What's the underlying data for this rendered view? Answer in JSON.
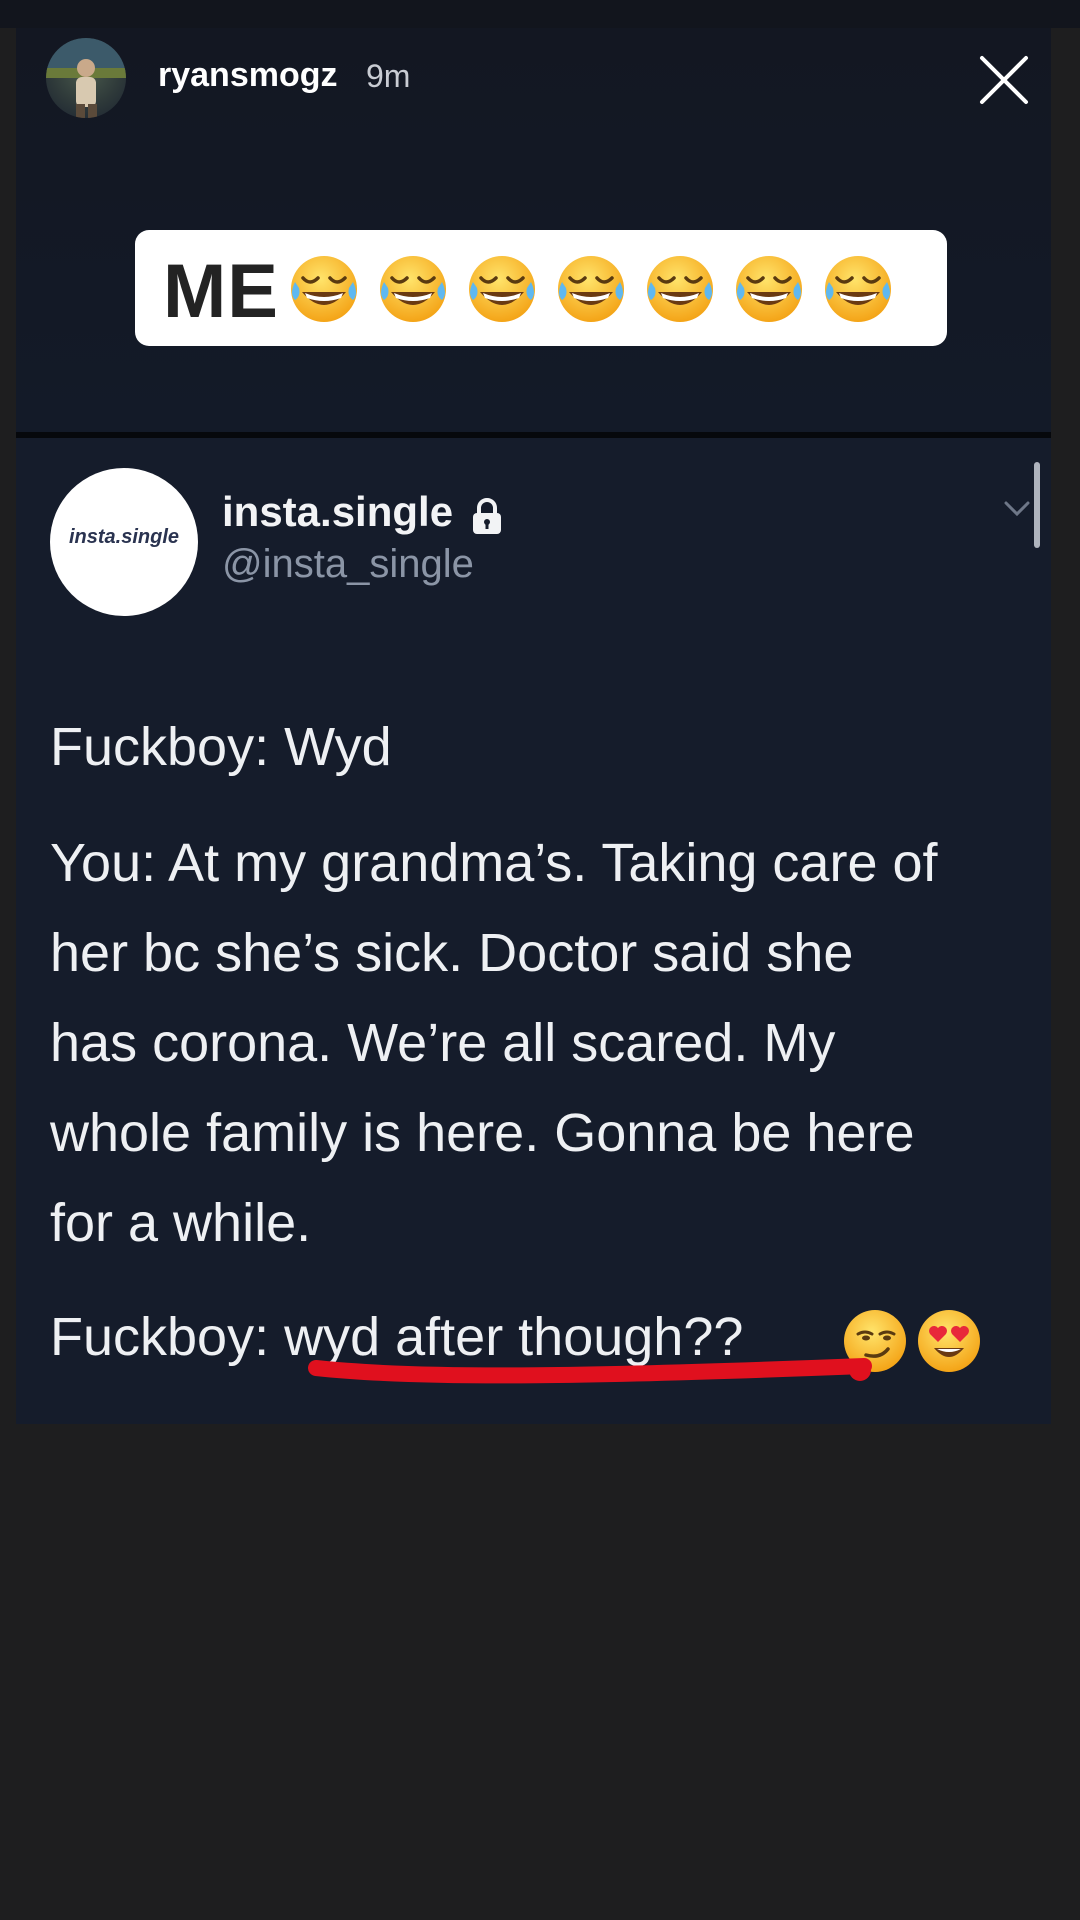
{
  "story": {
    "username": "ryansmogz",
    "timestamp": "9m",
    "close_icon": "close-x-icon",
    "caption_text": "ME",
    "caption_emoji": [
      "face-with-tears-of-joy",
      "face-with-tears-of-joy",
      "face-with-tears-of-joy",
      "face-with-tears-of-joy",
      "face-with-tears-of-joy",
      "face-with-tears-of-joy",
      "face-with-tears-of-joy"
    ]
  },
  "tweet": {
    "avatar_text": "insta.single",
    "display_name": "insta.single",
    "handle": "@insta_single",
    "protected_icon": "lock-icon",
    "lines": [
      "Fuckboy: Wyd",
      "You: At my grandma’s. Taking care of",
      "her bc she’s sick. Doctor said she",
      "has corona. We’re all scared. My",
      "whole family is here. Gonna be here",
      "for a while.",
      "Fuckboy: wyd after though??"
    ],
    "trailing_emoji": [
      "smirking-face",
      "smiling-face-with-heart-eyes"
    ],
    "highlight_color": "#e0101e"
  },
  "colors": {
    "story_bg": "#141925",
    "tweet_bg": "#151c2b",
    "page_bg": "#1e1e1f",
    "text": "#eef0f3",
    "muted": "#8b95a6"
  }
}
